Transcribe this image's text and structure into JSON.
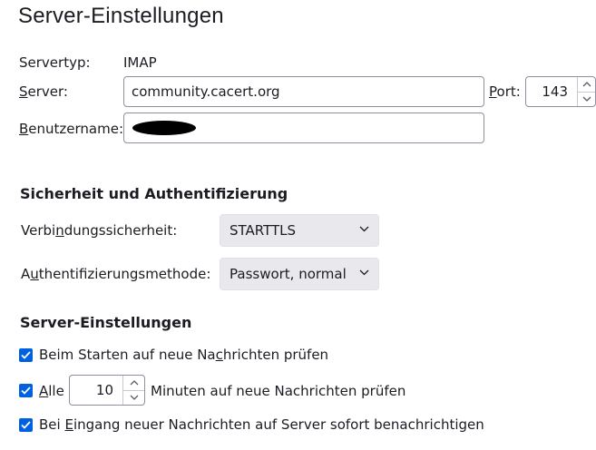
{
  "page_title": "Server-Einstellungen",
  "server_type": {
    "label": "Servertyp:",
    "value": "IMAP"
  },
  "server": {
    "label": "Server:",
    "label_underline": "S",
    "label_rest": "erver:",
    "value": "community.cacert.org"
  },
  "port": {
    "label_underline": "P",
    "label_rest": "ort:",
    "value": "143"
  },
  "username": {
    "label_underline": "B",
    "label_rest": "enutzername:"
  },
  "security_section": {
    "title": "Sicherheit und Authentifizierung",
    "connection_security": {
      "label_pre": "Verbi",
      "label_underline": "n",
      "label_post": "dungssicherheit:",
      "selected": "STARTTLS"
    },
    "auth_method": {
      "label_pre": "A",
      "label_underline": "u",
      "label_post": "thentifizierungsmethode:",
      "selected": "Passwort, normal"
    }
  },
  "server_settings_section": {
    "title": "Server-Einstellungen",
    "check_on_startup": {
      "checked": true,
      "label_pre": "Beim Starten auf neue Na",
      "label_underline": "c",
      "label_post": "hrichten prüfen"
    },
    "check_every": {
      "checked": true,
      "label_underline": "A",
      "label_rest": "lle",
      "minutes": "10",
      "suffix": "Minuten auf neue Nachrichten prüfen"
    },
    "notify_on_arrival": {
      "checked": true,
      "label_pre": "Bei ",
      "label_underline": "E",
      "label_post": "ingang neuer Nachrichten auf Server sofort benachrichtigen"
    }
  },
  "colors": {
    "accent": "#0061e0",
    "select_bg": "#e9e9ed",
    "border": "#8f8f9d"
  }
}
